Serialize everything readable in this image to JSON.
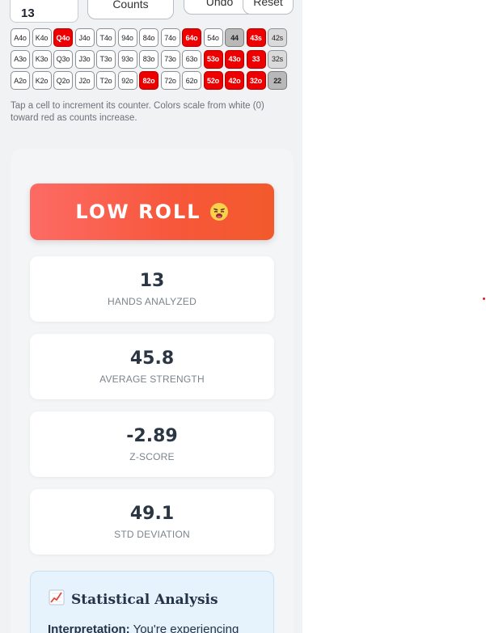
{
  "controls": {
    "counter_value": "13",
    "counts_label": "Counts",
    "undo_label": "Undo",
    "reset_label": "Reset"
  },
  "grid": {
    "rows": [
      [
        {
          "label": "A4o",
          "state": "white"
        },
        {
          "label": "K4o",
          "state": "white"
        },
        {
          "label": "Q4o",
          "state": "red"
        },
        {
          "label": "J4o",
          "state": "white"
        },
        {
          "label": "T4o",
          "state": "white"
        },
        {
          "label": "94o",
          "state": "white"
        },
        {
          "label": "84o",
          "state": "white"
        },
        {
          "label": "74o",
          "state": "white"
        },
        {
          "label": "64o",
          "state": "red"
        },
        {
          "label": "54o",
          "state": "white"
        },
        {
          "label": "44",
          "state": "grey"
        },
        {
          "label": "43s",
          "state": "red"
        },
        {
          "label": "42s",
          "state": "lightgrey"
        }
      ],
      [
        {
          "label": "A3o",
          "state": "white"
        },
        {
          "label": "K3o",
          "state": "white"
        },
        {
          "label": "Q3o",
          "state": "white"
        },
        {
          "label": "J3o",
          "state": "white"
        },
        {
          "label": "T3o",
          "state": "white"
        },
        {
          "label": "93o",
          "state": "white"
        },
        {
          "label": "83o",
          "state": "white"
        },
        {
          "label": "73o",
          "state": "white"
        },
        {
          "label": "63o",
          "state": "white"
        },
        {
          "label": "53o",
          "state": "red"
        },
        {
          "label": "43o",
          "state": "red"
        },
        {
          "label": "33",
          "state": "red"
        },
        {
          "label": "32s",
          "state": "lightgrey"
        }
      ],
      [
        {
          "label": "A2o",
          "state": "white"
        },
        {
          "label": "K2o",
          "state": "white"
        },
        {
          "label": "Q2o",
          "state": "white"
        },
        {
          "label": "J2o",
          "state": "white"
        },
        {
          "label": "T2o",
          "state": "white"
        },
        {
          "label": "92o",
          "state": "white"
        },
        {
          "label": "82o",
          "state": "red"
        },
        {
          "label": "72o",
          "state": "white"
        },
        {
          "label": "62o",
          "state": "white"
        },
        {
          "label": "52o",
          "state": "red"
        },
        {
          "label": "42o",
          "state": "red"
        },
        {
          "label": "32o",
          "state": "red"
        },
        {
          "label": "22",
          "state": "grey"
        }
      ]
    ]
  },
  "hint_text": "Tap a cell to increment its counter. Colors scale from white (0) toward red as counts increase.",
  "result": {
    "banner_label": "LOW ROLL",
    "banner_icon": "weary-face-icon",
    "stats": [
      {
        "value": "13",
        "label": "HANDS ANALYZED"
      },
      {
        "value": "45.8",
        "label": "AVERAGE STRENGTH"
      },
      {
        "value": "-2.89",
        "label": "Z-SCORE"
      },
      {
        "value": "49.1",
        "label": "STD DEVIATION"
      }
    ],
    "analysis_title": "Statistical Analysis",
    "analysis_icon": "chart-increasing-icon",
    "interpretation_label": "Interpretation:",
    "interpretation_text": "You're experiencing"
  },
  "colors": {
    "cell_red": "#ee0000",
    "cell_grey": "#b8b8b8",
    "banner_start": "#fd6b65",
    "banner_end": "#f25a2c",
    "analysis_bg": "#e6f2fc"
  }
}
